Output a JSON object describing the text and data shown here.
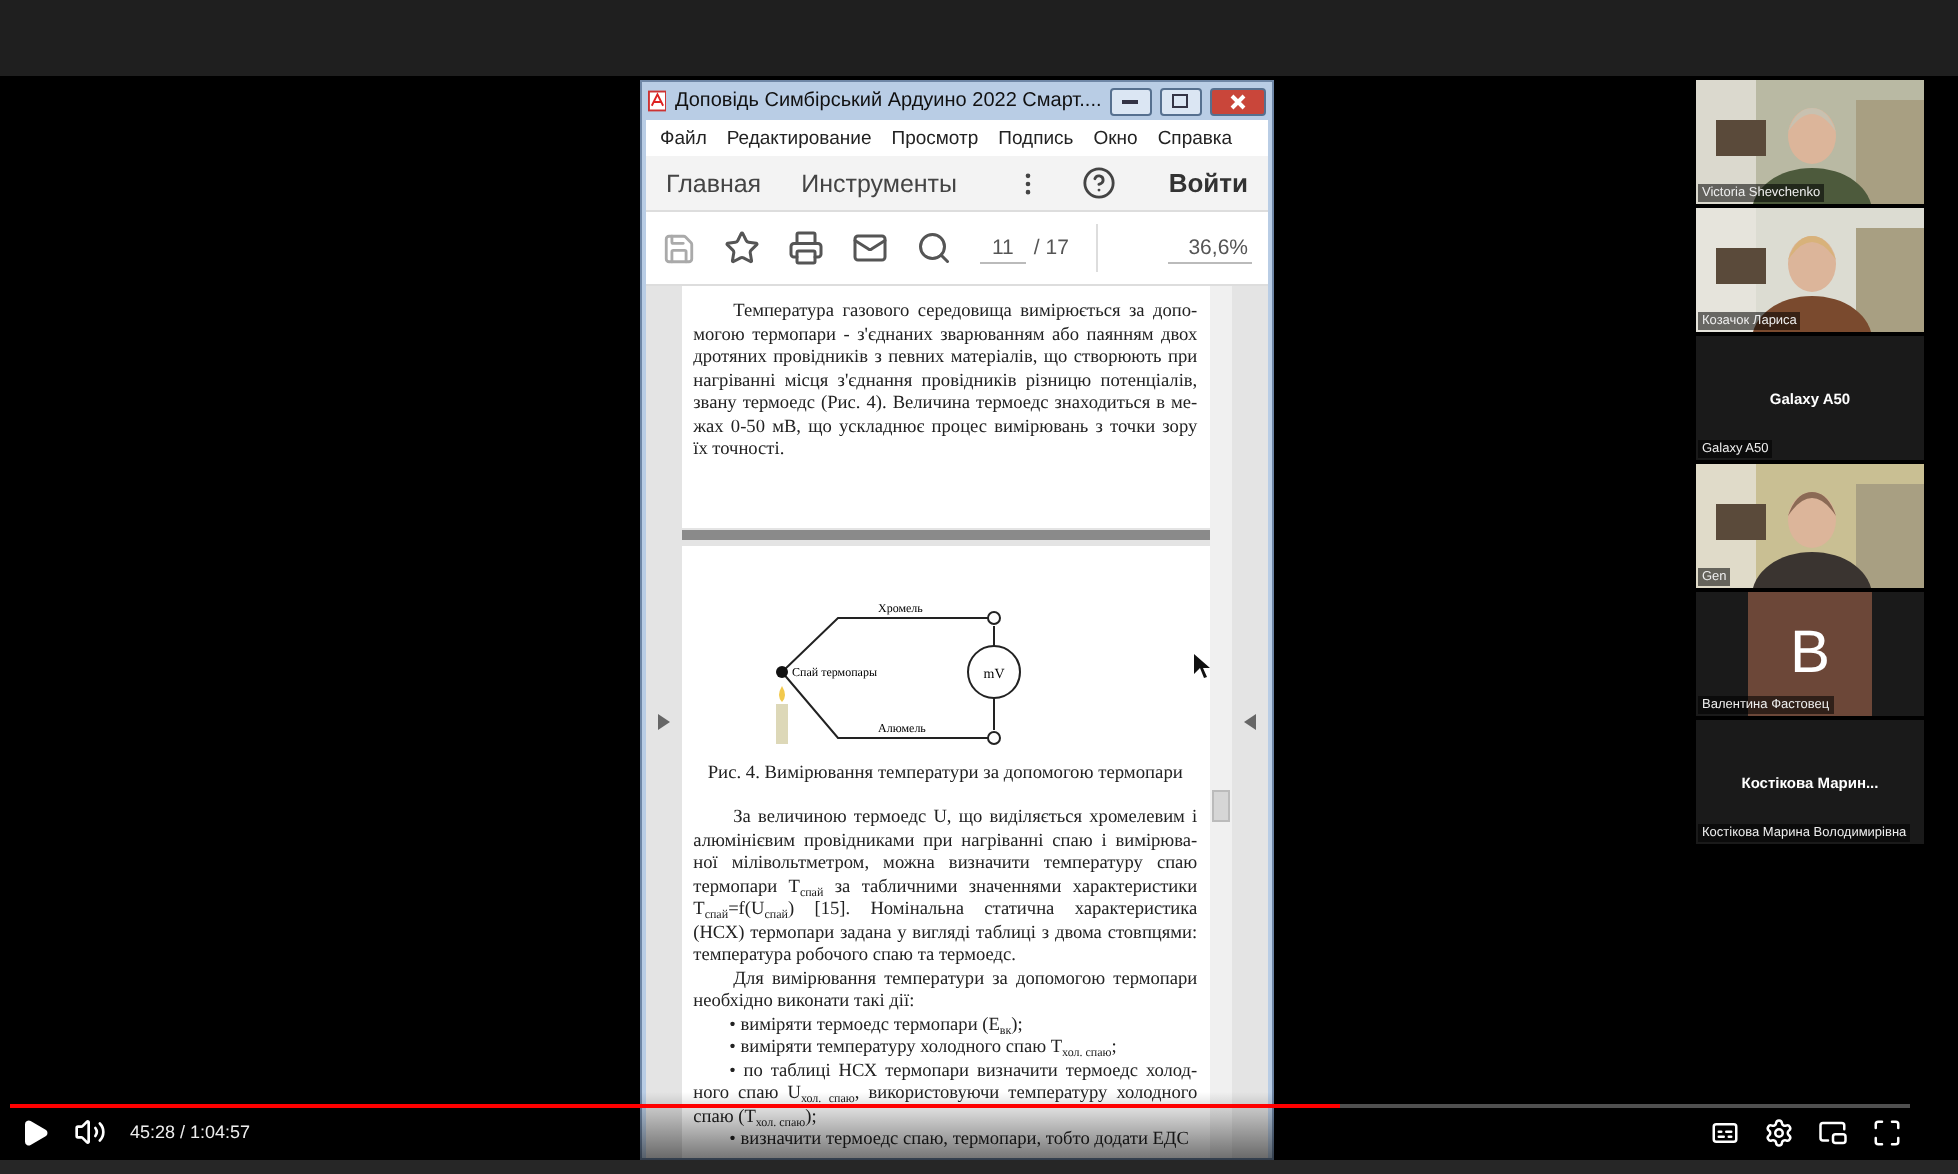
{
  "shared_window": {
    "title": "Доповідь Симбірський Ардуино 2022 Смарт....",
    "menu": [
      "Файл",
      "Редактирование",
      "Просмотр",
      "Подпись",
      "Окно",
      "Справка"
    ],
    "tabs": [
      "Главная",
      "Инструменты"
    ],
    "sign_in": "Войти",
    "page_current": "11",
    "page_total": "/ 17",
    "zoom": "36,6%"
  },
  "document": {
    "page_one": [
      {
        "kind": "para",
        "lines": [
          "Температура газового середовища вимірюється за допо-",
          "могою термопари - з'єднаних зварюванням або паянням двох",
          "дротяних провідників з певних матеріалів, що створюють при",
          "нагріванні місця з'єднання провідників різницю потенціалів,",
          "звану термоедс (Рис. 4). Величина термоедс знаходиться в ме-",
          "жах 0-50 мВ, що ускладнює процес вимірювань з точки зору",
          "їх точності."
        ]
      }
    ],
    "figure": {
      "top_wire": "Хромель",
      "junction": "Спай термопары",
      "bottom_wire": "Алюмель",
      "meter": "mV"
    },
    "caption": "Рис. 4. Вимірювання температури за допомогою термопари",
    "page_two": [
      {
        "kind": "para",
        "lines": [
          "За величиною термоедс U, що виділяється хромелевим і",
          "алюмінієвим провідниками при нагріванні спаю і вимірюва-",
          "ної мілівольтметром, можна визначити температуру спаю",
          "термопари T$_{спай}$ за табличними значеннями характеристики",
          "T$_{спай}$=f(U$_{спай}$) [15]. Номінальна статична характеристика",
          "(НСХ) термопари задана у вигляді таблиці з двома стовпцями:",
          "температура робочого спаю та термоедс."
        ]
      },
      {
        "kind": "para",
        "lines": [
          "Для вимірювання температури за допомогою термопари",
          "необхідно виконати такі дії:"
        ]
      },
      {
        "kind": "bullet",
        "lines": [
          "• виміряти термоедс термопари (E$_{вк}$);"
        ]
      },
      {
        "kind": "bullet",
        "lines": [
          "• виміряти температуру холодного спаю T$_{хол. спаю}$;"
        ]
      },
      {
        "kind": "bullet",
        "lines": [
          "• по таблиці НСХ термопари визначити термоедс холод-",
          "ного спаю U$_{хол. спаю}$, використовуючи температуру холодного",
          "спаю (T$_{хол. спаю}$);"
        ]
      },
      {
        "kind": "bullet",
        "lines": [
          "• визначити термоедс спаю, термопари, тобто додати ЕДС"
        ]
      }
    ]
  },
  "participants": [
    {
      "kind": "video",
      "name": "Victoria Shevchenko"
    },
    {
      "kind": "video",
      "name": "Козачок Лариса"
    },
    {
      "kind": "name",
      "display": "Galaxy A50",
      "name": "Galaxy A50"
    },
    {
      "kind": "video",
      "name": "Gen"
    },
    {
      "kind": "avatar",
      "initial": "B",
      "name": "Валентина Фастовец"
    },
    {
      "kind": "name",
      "display": "Костікова Марин...",
      "name": "Костікова Марина Володимирівна"
    }
  ],
  "player": {
    "time": "45:28 / 1:04:57",
    "progress": {
      "level": 0.7
    }
  }
}
